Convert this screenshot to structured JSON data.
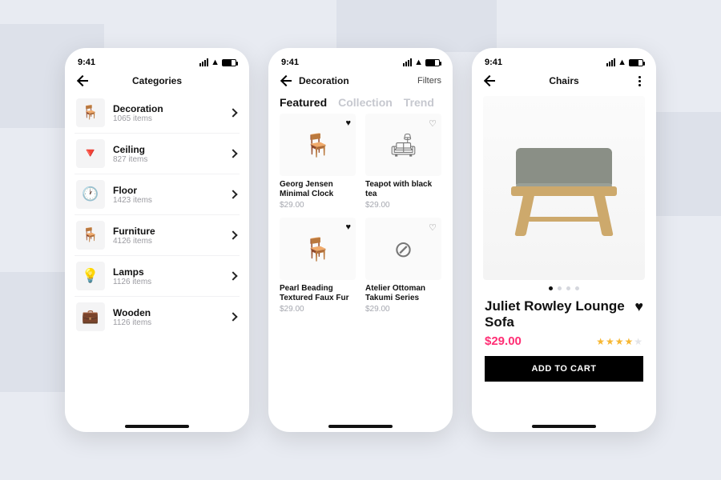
{
  "status": {
    "time": "9:41"
  },
  "screen1": {
    "title": "Categories",
    "items": [
      {
        "name": "Decoration",
        "sub": "1065 items",
        "icon": "🪑"
      },
      {
        "name": "Ceiling",
        "sub": "827 items",
        "icon": "🔻"
      },
      {
        "name": "Floor",
        "sub": "1423 items",
        "icon": "🕐"
      },
      {
        "name": "Furniture",
        "sub": "4126 items",
        "icon": "🪑"
      },
      {
        "name": "Lamps",
        "sub": "1126 items",
        "icon": "💡"
      },
      {
        "name": "Wooden",
        "sub": "1126 items",
        "icon": "💼"
      }
    ]
  },
  "screen2": {
    "back_label": "Decoration",
    "filters_label": "Filters",
    "tabs": {
      "featured": "Featured",
      "collection": "Collection",
      "trending": "Trend"
    },
    "products": [
      {
        "title": "Georg Jensen Minimal Clock",
        "price": "$29.00",
        "fav": true,
        "icon": "🪑"
      },
      {
        "title": "Teapot with black tea",
        "price": "$29.00",
        "fav": false,
        "icon": "🛋"
      },
      {
        "title": "Pearl Beading Textured Faux Fur",
        "price": "$29.00",
        "fav": true,
        "icon": "🪑"
      },
      {
        "title": "Atelier Ottoman Takumi Series",
        "price": "$29.00",
        "fav": false,
        "icon": "⊘"
      }
    ]
  },
  "screen3": {
    "title": "Chairs",
    "product_name": "Juliet Rowley Lounge Sofa",
    "price": "$29.00",
    "rating": 4,
    "add_label": "ADD TO CART"
  }
}
